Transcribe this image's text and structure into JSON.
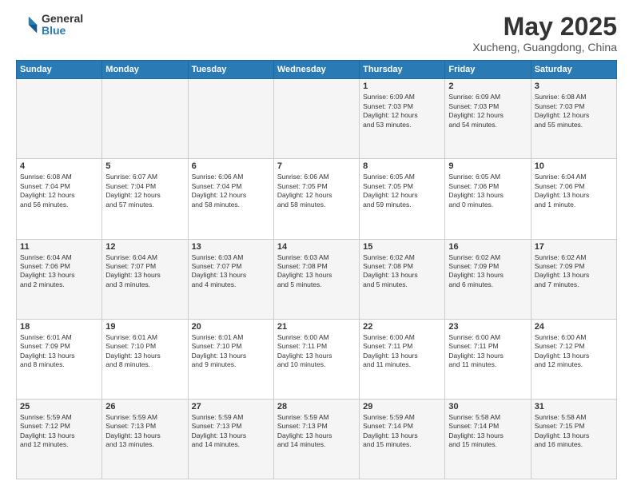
{
  "logo": {
    "general": "General",
    "blue": "Blue"
  },
  "header": {
    "month_year": "May 2025",
    "location": "Xucheng, Guangdong, China"
  },
  "days_of_week": [
    "Sunday",
    "Monday",
    "Tuesday",
    "Wednesday",
    "Thursday",
    "Friday",
    "Saturday"
  ],
  "weeks": [
    [
      {
        "day": "",
        "content": ""
      },
      {
        "day": "",
        "content": ""
      },
      {
        "day": "",
        "content": ""
      },
      {
        "day": "",
        "content": ""
      },
      {
        "day": "1",
        "content": "Sunrise: 6:09 AM\nSunset: 7:03 PM\nDaylight: 12 hours\nand 53 minutes."
      },
      {
        "day": "2",
        "content": "Sunrise: 6:09 AM\nSunset: 7:03 PM\nDaylight: 12 hours\nand 54 minutes."
      },
      {
        "day": "3",
        "content": "Sunrise: 6:08 AM\nSunset: 7:03 PM\nDaylight: 12 hours\nand 55 minutes."
      }
    ],
    [
      {
        "day": "4",
        "content": "Sunrise: 6:08 AM\nSunset: 7:04 PM\nDaylight: 12 hours\nand 56 minutes."
      },
      {
        "day": "5",
        "content": "Sunrise: 6:07 AM\nSunset: 7:04 PM\nDaylight: 12 hours\nand 57 minutes."
      },
      {
        "day": "6",
        "content": "Sunrise: 6:06 AM\nSunset: 7:04 PM\nDaylight: 12 hours\nand 58 minutes."
      },
      {
        "day": "7",
        "content": "Sunrise: 6:06 AM\nSunset: 7:05 PM\nDaylight: 12 hours\nand 58 minutes."
      },
      {
        "day": "8",
        "content": "Sunrise: 6:05 AM\nSunset: 7:05 PM\nDaylight: 12 hours\nand 59 minutes."
      },
      {
        "day": "9",
        "content": "Sunrise: 6:05 AM\nSunset: 7:06 PM\nDaylight: 13 hours\nand 0 minutes."
      },
      {
        "day": "10",
        "content": "Sunrise: 6:04 AM\nSunset: 7:06 PM\nDaylight: 13 hours\nand 1 minute."
      }
    ],
    [
      {
        "day": "11",
        "content": "Sunrise: 6:04 AM\nSunset: 7:06 PM\nDaylight: 13 hours\nand 2 minutes."
      },
      {
        "day": "12",
        "content": "Sunrise: 6:04 AM\nSunset: 7:07 PM\nDaylight: 13 hours\nand 3 minutes."
      },
      {
        "day": "13",
        "content": "Sunrise: 6:03 AM\nSunset: 7:07 PM\nDaylight: 13 hours\nand 4 minutes."
      },
      {
        "day": "14",
        "content": "Sunrise: 6:03 AM\nSunset: 7:08 PM\nDaylight: 13 hours\nand 5 minutes."
      },
      {
        "day": "15",
        "content": "Sunrise: 6:02 AM\nSunset: 7:08 PM\nDaylight: 13 hours\nand 5 minutes."
      },
      {
        "day": "16",
        "content": "Sunrise: 6:02 AM\nSunset: 7:09 PM\nDaylight: 13 hours\nand 6 minutes."
      },
      {
        "day": "17",
        "content": "Sunrise: 6:02 AM\nSunset: 7:09 PM\nDaylight: 13 hours\nand 7 minutes."
      }
    ],
    [
      {
        "day": "18",
        "content": "Sunrise: 6:01 AM\nSunset: 7:09 PM\nDaylight: 13 hours\nand 8 minutes."
      },
      {
        "day": "19",
        "content": "Sunrise: 6:01 AM\nSunset: 7:10 PM\nDaylight: 13 hours\nand 8 minutes."
      },
      {
        "day": "20",
        "content": "Sunrise: 6:01 AM\nSunset: 7:10 PM\nDaylight: 13 hours\nand 9 minutes."
      },
      {
        "day": "21",
        "content": "Sunrise: 6:00 AM\nSunset: 7:11 PM\nDaylight: 13 hours\nand 10 minutes."
      },
      {
        "day": "22",
        "content": "Sunrise: 6:00 AM\nSunset: 7:11 PM\nDaylight: 13 hours\nand 11 minutes."
      },
      {
        "day": "23",
        "content": "Sunrise: 6:00 AM\nSunset: 7:11 PM\nDaylight: 13 hours\nand 11 minutes."
      },
      {
        "day": "24",
        "content": "Sunrise: 6:00 AM\nSunset: 7:12 PM\nDaylight: 13 hours\nand 12 minutes."
      }
    ],
    [
      {
        "day": "25",
        "content": "Sunrise: 5:59 AM\nSunset: 7:12 PM\nDaylight: 13 hours\nand 12 minutes."
      },
      {
        "day": "26",
        "content": "Sunrise: 5:59 AM\nSunset: 7:13 PM\nDaylight: 13 hours\nand 13 minutes."
      },
      {
        "day": "27",
        "content": "Sunrise: 5:59 AM\nSunset: 7:13 PM\nDaylight: 13 hours\nand 14 minutes."
      },
      {
        "day": "28",
        "content": "Sunrise: 5:59 AM\nSunset: 7:13 PM\nDaylight: 13 hours\nand 14 minutes."
      },
      {
        "day": "29",
        "content": "Sunrise: 5:59 AM\nSunset: 7:14 PM\nDaylight: 13 hours\nand 15 minutes."
      },
      {
        "day": "30",
        "content": "Sunrise: 5:58 AM\nSunset: 7:14 PM\nDaylight: 13 hours\nand 15 minutes."
      },
      {
        "day": "31",
        "content": "Sunrise: 5:58 AM\nSunset: 7:15 PM\nDaylight: 13 hours\nand 16 minutes."
      }
    ]
  ]
}
